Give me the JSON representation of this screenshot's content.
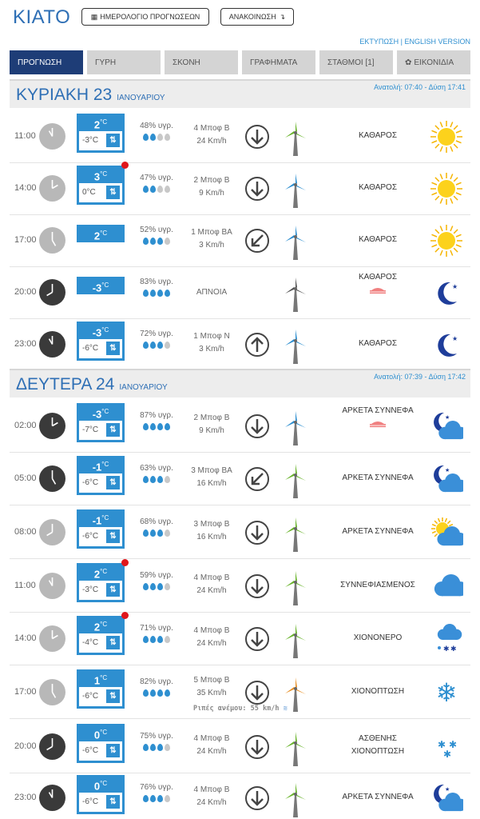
{
  "header": {
    "city": "ΚΙΑΤΟ",
    "calendar_button": "ΗΜΕΡΟΛΟΓΙΟ ΠΡΟΓΝΩΣΕΩΝ",
    "announce_button": "ΑΝΑΚΟΙΝΩΣΗ",
    "print_link": "ΕΚΤΥΠΩΣΗ",
    "separator": " | ",
    "english_link": "ENGLISH VERSION"
  },
  "tabs": [
    "ΠΡΟΓΝΩΣΗ",
    "ΓΥΡΗ",
    "ΣΚΟΝΗ",
    "ΓΡΑΦΗΜΑΤΑ",
    "ΣΤΑΘΜΟΙ [1]",
    "ΕΙΚΟΝΙΔΙΑ"
  ],
  "days": [
    {
      "name": "ΚΥΡΙΑΚΗ 23",
      "month": "ΙΑΝΟΥΑΡΙΟΥ",
      "sun": "Ανατολή: 07:40 - Δύση 17:41",
      "rows": [
        {
          "time": "11:00",
          "period": "day",
          "tmax": "2",
          "tmin": "-3°C",
          "alert": false,
          "hum": "48% υγρ.",
          "drops": 2,
          "wind1": "4 Μποφ Β",
          "wind2": "24 Km/h",
          "dir": "down",
          "turbine": "green",
          "cond": "ΚΑΘΑΡΟΣ",
          "fog": false,
          "icon": "sun"
        },
        {
          "time": "14:00",
          "period": "day",
          "tmax": "3",
          "tmin": "0°C",
          "alert": true,
          "hum": "47% υγρ.",
          "drops": 2,
          "wind1": "2 Μποφ Β",
          "wind2": "9 Km/h",
          "dir": "down",
          "turbine": "blue",
          "cond": "ΚΑΘΑΡΟΣ",
          "fog": false,
          "icon": "sun"
        },
        {
          "time": "17:00",
          "period": "day",
          "tmax": "2",
          "tmin": "",
          "alert": false,
          "hum": "52% υγρ.",
          "drops": 3,
          "wind1": "1 Μποφ ΒΑ",
          "wind2": "3 Km/h",
          "dir": "downleft",
          "turbine": "blue",
          "cond": "ΚΑΘΑΡΟΣ",
          "fog": false,
          "icon": "sun"
        },
        {
          "time": "20:00",
          "period": "night",
          "tmax": "-3",
          "tmin": "",
          "alert": false,
          "hum": "83% υγρ.",
          "drops": 4,
          "wind1": "",
          "wind2": "",
          "calm": "ΑΠΝΟΙΑ",
          "dir": "",
          "turbine": "gray",
          "cond": "ΚΑΘΑΡΟΣ",
          "fog": true,
          "icon": "moon"
        },
        {
          "time": "23:00",
          "period": "night",
          "tmax": "-3",
          "tmin": "-6°C",
          "alert": false,
          "hum": "72% υγρ.",
          "drops": 3,
          "wind1": "1 Μποφ Ν",
          "wind2": "3 Km/h",
          "dir": "up",
          "turbine": "blue",
          "cond": "ΚΑΘΑΡΟΣ",
          "fog": false,
          "icon": "moon"
        }
      ]
    },
    {
      "name": "ΔΕΥΤΕΡΑ 24",
      "month": "ΙΑΝΟΥΑΡΙΟΥ",
      "sun": "Ανατολή: 07:39 - Δύση 17:42",
      "rows": [
        {
          "time": "02:00",
          "period": "night",
          "tmax": "-3",
          "tmin": "-7°C",
          "alert": false,
          "hum": "87% υγρ.",
          "drops": 4,
          "wind1": "2 Μποφ Β",
          "wind2": "9 Km/h",
          "dir": "down",
          "turbine": "blue",
          "cond": "ΑΡΚΕΤΑ ΣΥΝΝΕΦΑ",
          "fog": true,
          "icon": "moon-cloud"
        },
        {
          "time": "05:00",
          "period": "night",
          "tmax": "-1",
          "tmin": "-6°C",
          "alert": false,
          "hum": "63% υγρ.",
          "drops": 3,
          "wind1": "3 Μποφ ΒΑ",
          "wind2": "16 Km/h",
          "dir": "downleft",
          "turbine": "green",
          "cond": "ΑΡΚΕΤΑ ΣΥΝΝΕΦΑ",
          "fog": false,
          "icon": "moon-cloud"
        },
        {
          "time": "08:00",
          "period": "day",
          "tmax": "-1",
          "tmin": "-6°C",
          "alert": false,
          "hum": "68% υγρ.",
          "drops": 3,
          "wind1": "3 Μποφ Β",
          "wind2": "16 Km/h",
          "dir": "down",
          "turbine": "green",
          "cond": "ΑΡΚΕΤΑ ΣΥΝΝΕΦΑ",
          "fog": false,
          "icon": "sun-cloud"
        },
        {
          "time": "11:00",
          "period": "day",
          "tmax": "2",
          "tmin": "-3°C",
          "alert": true,
          "hum": "59% υγρ.",
          "drops": 3,
          "wind1": "4 Μποφ Β",
          "wind2": "24 Km/h",
          "dir": "down",
          "turbine": "green",
          "cond": "ΣΥΝΝΕΦΙΑΣΜΕΝΟΣ",
          "fog": false,
          "icon": "cloud"
        },
        {
          "time": "14:00",
          "period": "day",
          "tmax": "2",
          "tmin": "-4°C",
          "alert": true,
          "hum": "71% υγρ.",
          "drops": 3,
          "wind1": "4 Μποφ Β",
          "wind2": "24 Km/h",
          "dir": "down",
          "turbine": "green",
          "cond": "ΧΙΟΝΟΝΕΡΟ",
          "fog": false,
          "icon": "sleet"
        },
        {
          "time": "17:00",
          "period": "day",
          "tmax": "1",
          "tmin": "-6°C",
          "alert": false,
          "hum": "82% υγρ.",
          "drops": 4,
          "wind1": "5 Μποφ Β",
          "wind2": "35 Km/h",
          "gust": "Ριπές ανέμου: 55 km/h",
          "dir": "down",
          "turbine": "orange",
          "cond": "ΧΙΟΝΟΠΤΩΣΗ",
          "fog": false,
          "icon": "snowflake"
        },
        {
          "time": "20:00",
          "period": "night",
          "tmax": "0",
          "tmin": "-6°C",
          "alert": false,
          "hum": "75% υγρ.",
          "drops": 3,
          "wind1": "4 Μποφ Β",
          "wind2": "24 Km/h",
          "dir": "down",
          "turbine": "green",
          "cond": "ΑΣΘΕΝΗΣ ΧΙΟΝΟΠΤΩΣΗ",
          "fog": false,
          "icon": "light-snow"
        },
        {
          "time": "23:00",
          "period": "night",
          "tmax": "0",
          "tmin": "-6°C",
          "alert": false,
          "hum": "76% υγρ.",
          "drops": 3,
          "wind1": "4 Μποφ Β",
          "wind2": "24 Km/h",
          "dir": "down",
          "turbine": "green",
          "cond": "ΑΡΚΕΤΑ ΣΥΝΝΕΦΑ",
          "fog": false,
          "icon": "moon-cloud"
        }
      ]
    }
  ],
  "colors": {
    "accent": "#2e8fd0",
    "brand": "#2e6fb5",
    "tab_active": "#1e3d77",
    "alert": "#e0161b"
  }
}
